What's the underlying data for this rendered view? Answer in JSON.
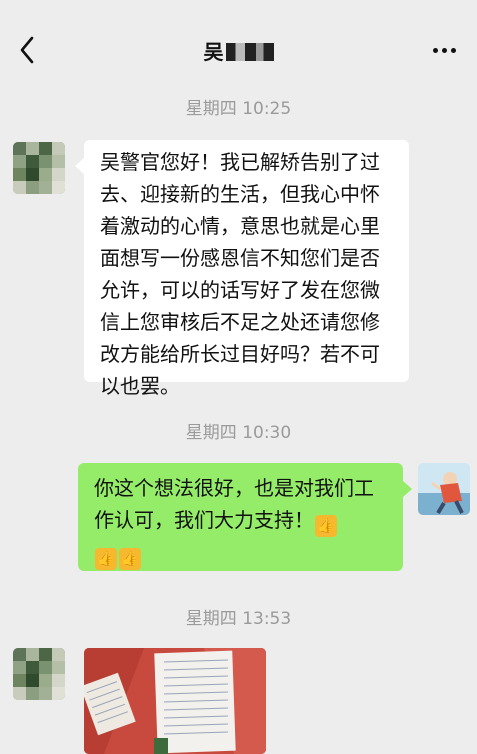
{
  "header": {
    "title": "吴",
    "back_icon": "chevron-left-icon",
    "more_icon": "more-dots-icon"
  },
  "messages": [
    {
      "timestamp": "星期四 10:25",
      "sender": "contact",
      "text": "吴警官您好！我已解矫告别了过去、迎接新的生活，但我心中怀着激动的心情，意思也就是心里面想写一份感恩信不知您们是否允许，可以的话写好了发在您微信上您审核后不足之处还请您修改方能给所长过目好吗？若不可以也罢。"
    },
    {
      "timestamp": "星期四 10:30",
      "sender": "me",
      "text": "你这个想法很好，也是对我们工作认可，我们大力支持！",
      "emoji": [
        "thumbs-up-icon",
        "thumbs-up-icon",
        "thumbs-up-icon"
      ]
    },
    {
      "timestamp": "星期四 13:53",
      "sender": "contact",
      "type": "image",
      "image_desc_icon": "letter-photo-icon"
    }
  ],
  "colors": {
    "background": "#ededed",
    "bubble_incoming": "#ffffff",
    "bubble_outgoing": "#95ec69",
    "timestamp": "#9a9a9a"
  }
}
